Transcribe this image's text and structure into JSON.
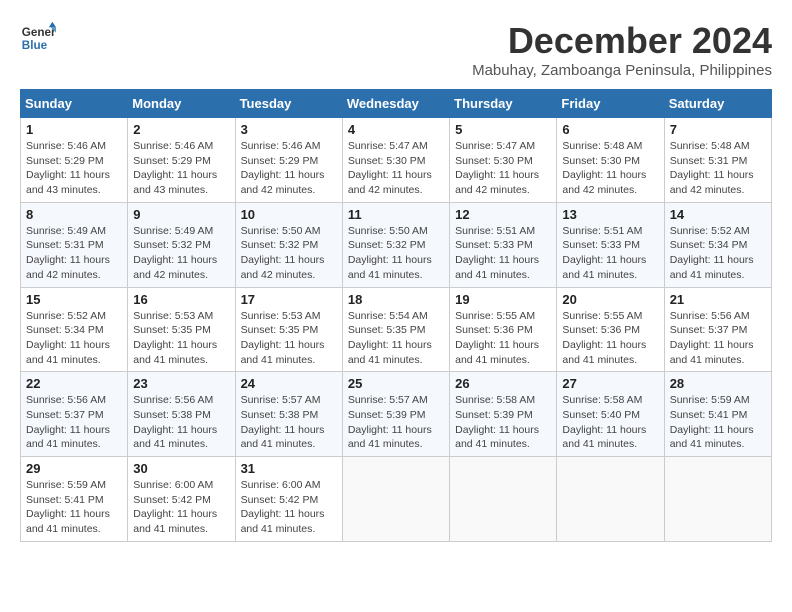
{
  "header": {
    "logo_line1": "General",
    "logo_line2": "Blue",
    "month_title": "December 2024",
    "location": "Mabuhay, Zamboanga Peninsula, Philippines"
  },
  "weekdays": [
    "Sunday",
    "Monday",
    "Tuesday",
    "Wednesday",
    "Thursday",
    "Friday",
    "Saturday"
  ],
  "weeks": [
    [
      {
        "day": "1",
        "sunrise": "5:46 AM",
        "sunset": "5:29 PM",
        "daylight": "11 hours and 43 minutes."
      },
      {
        "day": "2",
        "sunrise": "5:46 AM",
        "sunset": "5:29 PM",
        "daylight": "11 hours and 43 minutes."
      },
      {
        "day": "3",
        "sunrise": "5:46 AM",
        "sunset": "5:29 PM",
        "daylight": "11 hours and 42 minutes."
      },
      {
        "day": "4",
        "sunrise": "5:47 AM",
        "sunset": "5:30 PM",
        "daylight": "11 hours and 42 minutes."
      },
      {
        "day": "5",
        "sunrise": "5:47 AM",
        "sunset": "5:30 PM",
        "daylight": "11 hours and 42 minutes."
      },
      {
        "day": "6",
        "sunrise": "5:48 AM",
        "sunset": "5:30 PM",
        "daylight": "11 hours and 42 minutes."
      },
      {
        "day": "7",
        "sunrise": "5:48 AM",
        "sunset": "5:31 PM",
        "daylight": "11 hours and 42 minutes."
      }
    ],
    [
      {
        "day": "8",
        "sunrise": "5:49 AM",
        "sunset": "5:31 PM",
        "daylight": "11 hours and 42 minutes."
      },
      {
        "day": "9",
        "sunrise": "5:49 AM",
        "sunset": "5:32 PM",
        "daylight": "11 hours and 42 minutes."
      },
      {
        "day": "10",
        "sunrise": "5:50 AM",
        "sunset": "5:32 PM",
        "daylight": "11 hours and 42 minutes."
      },
      {
        "day": "11",
        "sunrise": "5:50 AM",
        "sunset": "5:32 PM",
        "daylight": "11 hours and 41 minutes."
      },
      {
        "day": "12",
        "sunrise": "5:51 AM",
        "sunset": "5:33 PM",
        "daylight": "11 hours and 41 minutes."
      },
      {
        "day": "13",
        "sunrise": "5:51 AM",
        "sunset": "5:33 PM",
        "daylight": "11 hours and 41 minutes."
      },
      {
        "day": "14",
        "sunrise": "5:52 AM",
        "sunset": "5:34 PM",
        "daylight": "11 hours and 41 minutes."
      }
    ],
    [
      {
        "day": "15",
        "sunrise": "5:52 AM",
        "sunset": "5:34 PM",
        "daylight": "11 hours and 41 minutes."
      },
      {
        "day": "16",
        "sunrise": "5:53 AM",
        "sunset": "5:35 PM",
        "daylight": "11 hours and 41 minutes."
      },
      {
        "day": "17",
        "sunrise": "5:53 AM",
        "sunset": "5:35 PM",
        "daylight": "11 hours and 41 minutes."
      },
      {
        "day": "18",
        "sunrise": "5:54 AM",
        "sunset": "5:35 PM",
        "daylight": "11 hours and 41 minutes."
      },
      {
        "day": "19",
        "sunrise": "5:55 AM",
        "sunset": "5:36 PM",
        "daylight": "11 hours and 41 minutes."
      },
      {
        "day": "20",
        "sunrise": "5:55 AM",
        "sunset": "5:36 PM",
        "daylight": "11 hours and 41 minutes."
      },
      {
        "day": "21",
        "sunrise": "5:56 AM",
        "sunset": "5:37 PM",
        "daylight": "11 hours and 41 minutes."
      }
    ],
    [
      {
        "day": "22",
        "sunrise": "5:56 AM",
        "sunset": "5:37 PM",
        "daylight": "11 hours and 41 minutes."
      },
      {
        "day": "23",
        "sunrise": "5:56 AM",
        "sunset": "5:38 PM",
        "daylight": "11 hours and 41 minutes."
      },
      {
        "day": "24",
        "sunrise": "5:57 AM",
        "sunset": "5:38 PM",
        "daylight": "11 hours and 41 minutes."
      },
      {
        "day": "25",
        "sunrise": "5:57 AM",
        "sunset": "5:39 PM",
        "daylight": "11 hours and 41 minutes."
      },
      {
        "day": "26",
        "sunrise": "5:58 AM",
        "sunset": "5:39 PM",
        "daylight": "11 hours and 41 minutes."
      },
      {
        "day": "27",
        "sunrise": "5:58 AM",
        "sunset": "5:40 PM",
        "daylight": "11 hours and 41 minutes."
      },
      {
        "day": "28",
        "sunrise": "5:59 AM",
        "sunset": "5:41 PM",
        "daylight": "11 hours and 41 minutes."
      }
    ],
    [
      {
        "day": "29",
        "sunrise": "5:59 AM",
        "sunset": "5:41 PM",
        "daylight": "11 hours and 41 minutes."
      },
      {
        "day": "30",
        "sunrise": "6:00 AM",
        "sunset": "5:42 PM",
        "daylight": "11 hours and 41 minutes."
      },
      {
        "day": "31",
        "sunrise": "6:00 AM",
        "sunset": "5:42 PM",
        "daylight": "11 hours and 41 minutes."
      },
      null,
      null,
      null,
      null
    ]
  ],
  "labels": {
    "sunrise": "Sunrise:",
    "sunset": "Sunset:",
    "daylight": "Daylight:"
  }
}
